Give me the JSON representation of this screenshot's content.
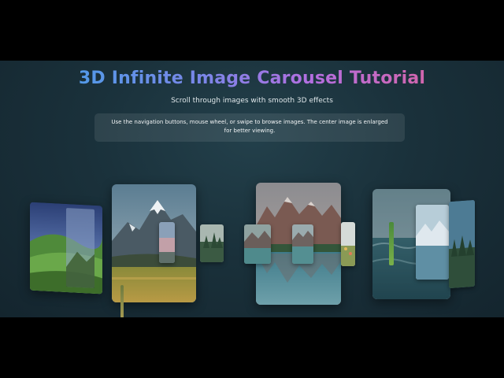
{
  "header": {
    "title": "3D Infinite Image Carousel Tutorial",
    "subtitle": "Scroll through images with smooth 3D effects"
  },
  "info_box": {
    "text": "Use the navigation buttons, mouse wheel, or swipe to browse images. The center image is enlarged for better viewing."
  },
  "carousel": {
    "images": [
      {
        "subject": "green hills with starry sky"
      },
      {
        "subject": "snowy mountain over golden meadow"
      },
      {
        "subject": "forest path"
      },
      {
        "subject": "mountain lake reflection"
      },
      {
        "subject": "wildflowers"
      },
      {
        "subject": "ocean waves"
      },
      {
        "subject": "lake with snowy peaks"
      },
      {
        "subject": "pine forest"
      }
    ]
  }
}
